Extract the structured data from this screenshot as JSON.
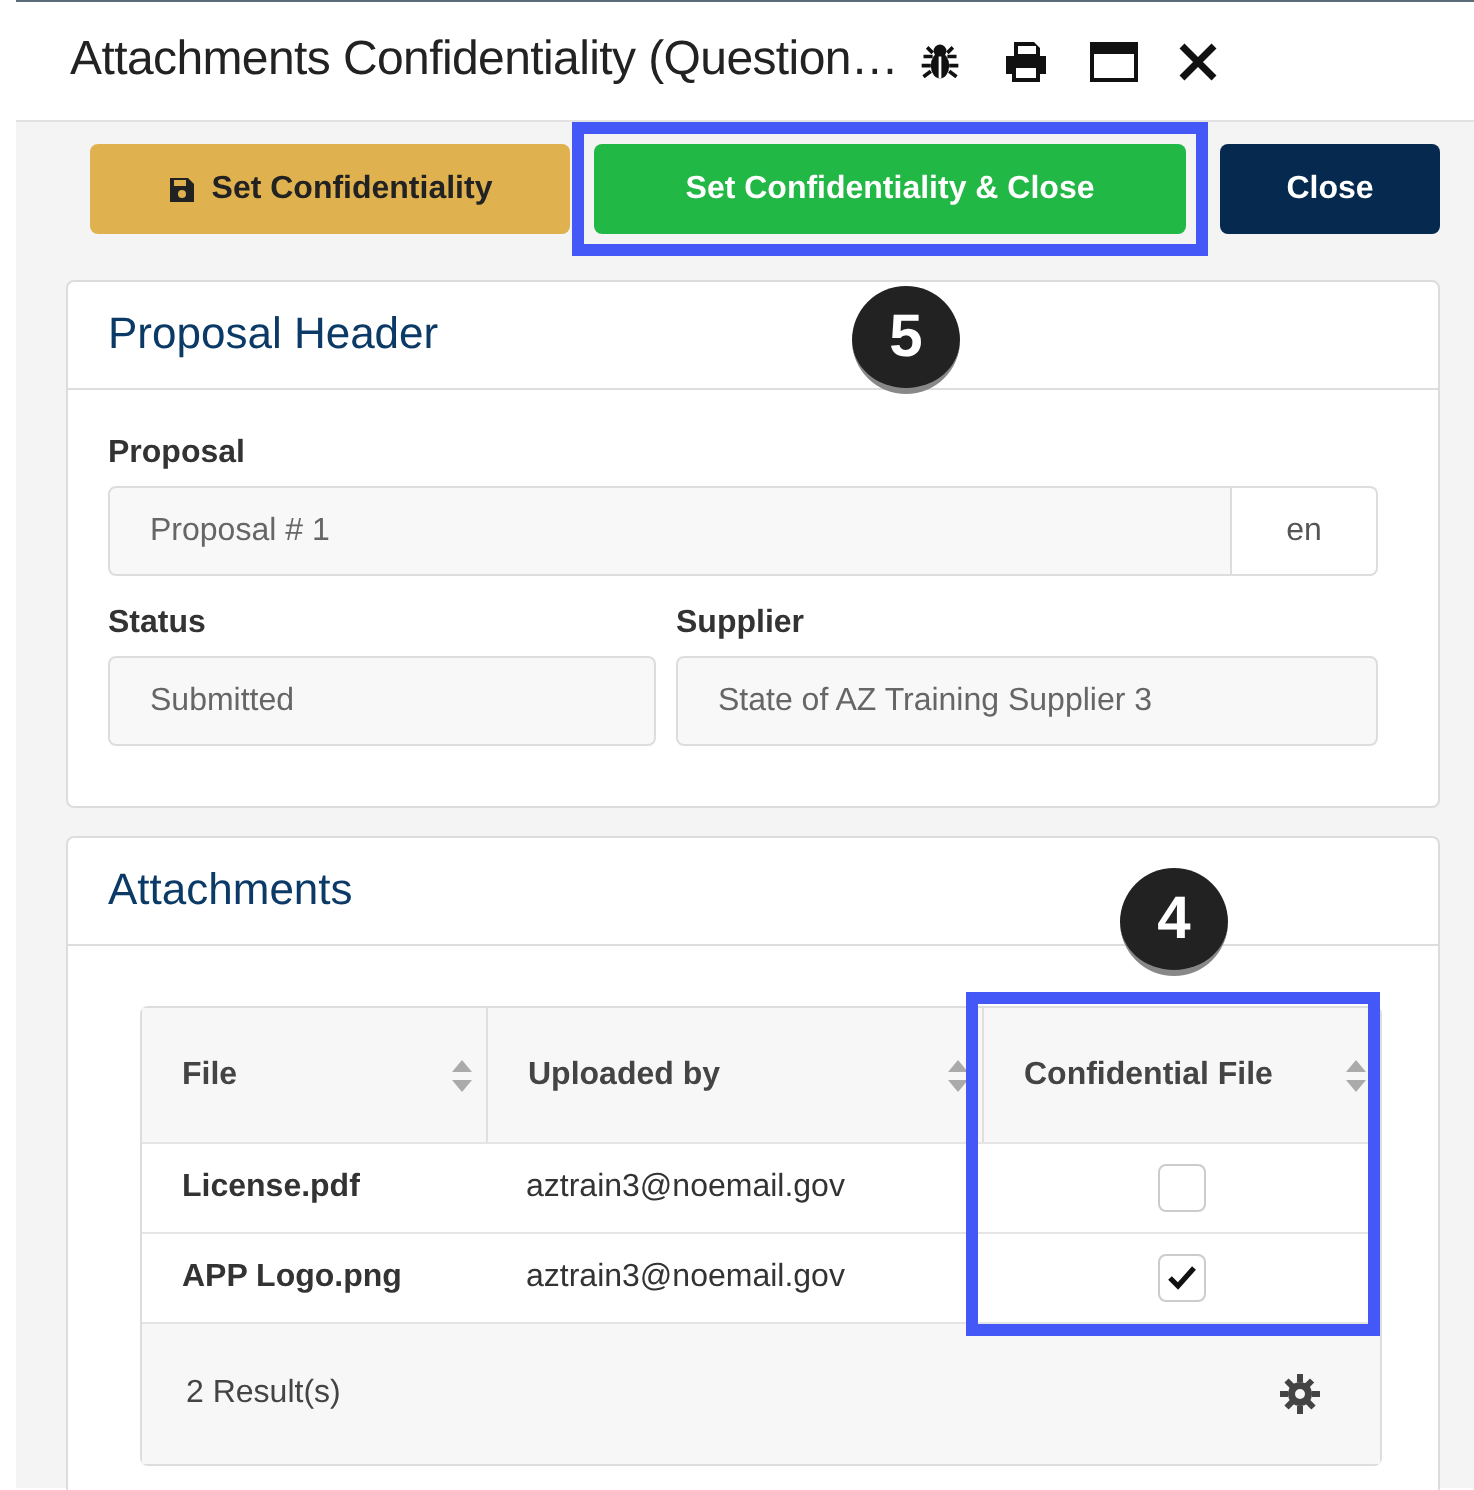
{
  "window": {
    "title": "Attachments Confidentiality (Question…"
  },
  "buttons": [
    {
      "label": "Set Confidentiality",
      "kind": "warning",
      "highlighted": false
    },
    {
      "label": "Set Confidentiality & Close",
      "kind": "success",
      "highlighted": true
    },
    {
      "label": "Close",
      "kind": "primary",
      "highlighted": false
    }
  ],
  "proposal_header": {
    "title": "Proposal Header",
    "callout": "5",
    "proposal": {
      "label": "Proposal",
      "value": "Proposal # 1",
      "addon": "en"
    },
    "status": {
      "label": "Status",
      "value": "Submitted"
    },
    "supplier": {
      "label": "Supplier",
      "value": "State of AZ Training Supplier 3"
    }
  },
  "attachments": {
    "title": "Attachments",
    "callout": "4",
    "table": {
      "columns": [
        {
          "label": "File",
          "highlighted": false
        },
        {
          "label": "Uploaded by",
          "highlighted": false
        },
        {
          "label": "Confidential File",
          "highlighted": true
        }
      ],
      "rows": [
        {
          "file": "License.pdf",
          "uploaded_by": "aztrain3@noemail.gov",
          "confidential": false
        },
        {
          "file": "APP Logo.png",
          "uploaded_by": "aztrain3@noemail.gov",
          "confidential": true
        }
      ],
      "footer": "2 Result(s)"
    }
  }
}
